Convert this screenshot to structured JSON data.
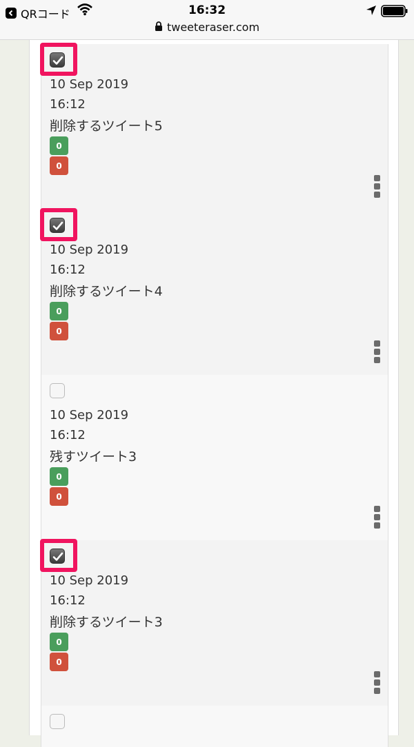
{
  "status": {
    "back_app": "QRコード",
    "time": "16:32",
    "url": "tweeteraser.com"
  },
  "tweets": [
    {
      "date": "10 Sep 2019",
      "time": "16:12",
      "text": "削除するツイート5",
      "green": "0",
      "red": "0",
      "checked": true
    },
    {
      "date": "10 Sep 2019",
      "time": "16:12",
      "text": "削除するツイート4",
      "green": "0",
      "red": "0",
      "checked": true
    },
    {
      "date": "10 Sep 2019",
      "time": "16:12",
      "text": "残すツイート3",
      "green": "0",
      "red": "0",
      "checked": false
    },
    {
      "date": "10 Sep 2019",
      "time": "16:12",
      "text": "削除するツイート3",
      "green": "0",
      "red": "0",
      "checked": true
    }
  ],
  "colors": {
    "highlight": "#f0145f",
    "green_badge": "#4a9e5c",
    "red_badge": "#d0513c"
  },
  "icons": {
    "checkbox_checked": "check-icon",
    "more": "vertical-dots-icon"
  }
}
